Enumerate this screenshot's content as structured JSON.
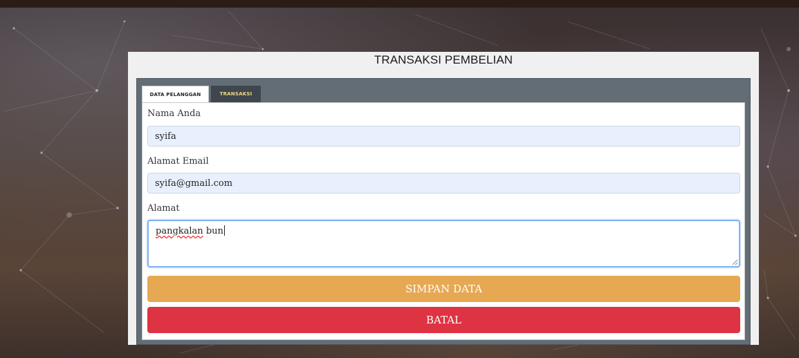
{
  "panel": {
    "title": "TRANSAKSI PEMBELIAN"
  },
  "tabs": [
    {
      "label": "DATA PELANGGAN",
      "active": true
    },
    {
      "label": "TRANSAKSI",
      "active": false
    }
  ],
  "form": {
    "name_label": "Nama Anda",
    "name_value": "syifa",
    "email_label": "Alamat Email",
    "email_value": "syifa@gmail.com",
    "address_label": "Alamat",
    "address_word_misspelled": "pangkalan",
    "address_rest": " bun"
  },
  "buttons": {
    "save_label": "SIMPAN DATA",
    "cancel_label": "BATAL"
  },
  "colors": {
    "save_button": "#e6a852",
    "cancel_button": "#de3343",
    "inactive_tab_text": "#f2d77a",
    "input_autofill_bg": "#e8f0fe"
  }
}
